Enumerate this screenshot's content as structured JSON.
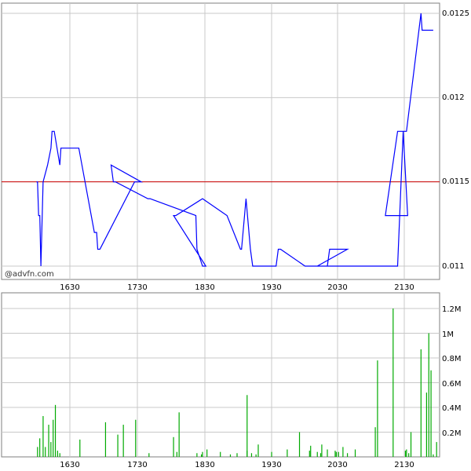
{
  "watermark": "@advfn.com",
  "price_panel": {
    "y_ticks": [
      "0.0125",
      "0.012",
      "0.0115",
      "0.011"
    ],
    "x_ticks": [
      "1630",
      "1730",
      "1830",
      "1930",
      "2030",
      "2130"
    ],
    "reference_level": 0.0115,
    "line_color": "#0000ff",
    "reference_color": "#cc0000"
  },
  "volume_panel": {
    "y_ticks": [
      "1.2M",
      "1M",
      "0.8M",
      "0.6M",
      "0.4M",
      "0.2M"
    ],
    "x_ticks": [
      "1630",
      "1730",
      "1830",
      "1930",
      "2030",
      "2130"
    ],
    "bar_color": "#00aa00"
  },
  "chart_data": [
    {
      "type": "line",
      "series": [
        {
          "x": [
            1600,
            1601,
            1602,
            1603,
            1604,
            1606,
            1610,
            1613,
            1614,
            1615,
            1615.5,
            1616,
            1621,
            1622,
            1631,
            1632,
            1636,
            1637,
            1638,
            1652,
            1653,
            1654,
            1655,
            1656,
            1657,
            1688,
            1689,
            1690,
            1694,
            1707,
            1709,
            1711,
            1740,
            1742,
            1783,
            1784,
            1789,
            1792,
            1803,
            1805,
            1829,
            1851,
            1903,
            1904,
            1908,
            1912,
            1914,
            1935,
            1937,
            1939,
            1961,
            1981,
            1983,
            1999,
            2012,
            2015,
            2084,
            2089,
            2093,
            2113,
            2124,
            2126,
            2132,
            2145,
            2146,
            2151,
            2152,
            2153,
            2154,
            2155,
            2156
          ],
          "y": [
            0.0115,
            0.0115,
            0.0113,
            0.0113,
            0.011,
            0.0115,
            0.0116,
            0.0117,
            0.0118,
            0.0118,
            0.0118,
            0.0118,
            0.0116,
            0.0117,
            0.0117,
            0.0117,
            0.0117,
            0.0117,
            0.0117,
            0.0112,
            0.0112,
            0.0112,
            0.0111,
            0.0111,
            0.0111,
            0.0115,
            0.0115,
            0.0115,
            0.0115,
            0.0116,
            0.0115,
            0.0115,
            0.0114,
            0.0114,
            0.0113,
            0.0111,
            0.011,
            0.011,
            0.0113,
            0.0113,
            0.0114,
            0.0113,
            0.0111,
            0.0111,
            0.0114,
            0.0111,
            0.011,
            0.011,
            0.0111,
            0.0111,
            0.011,
            0.011,
            0.0111,
            0.0111,
            0.011,
            0.011,
            0.011,
            0.0118,
            0.0113,
            0.0113,
            0.0118,
            0.0118,
            0.0118,
            0.0125,
            0.0124,
            0.0124,
            0.0124,
            0.0124,
            0.0124,
            0.0124,
            0.0124
          ]
        }
      ],
      "xlim": [
        1600,
        2160
      ],
      "ylim": [
        0.01095,
        0.0126
      ]
    },
    {
      "type": "bar",
      "x": [
        1601,
        1603,
        1606,
        1608,
        1611,
        1613,
        1615,
        1617,
        1619,
        1621,
        1639,
        1662,
        1678,
        1689,
        1713,
        1741,
        1766,
        1784,
        1789,
        1793,
        1803,
        1808,
        1828,
        1845,
        1854,
        1869,
        1879,
        1900,
        1909,
        1913,
        1917,
        1931,
        1945,
        1956,
        1966,
        1975,
        1981,
        1989,
        1995,
        1999,
        2005,
        2012,
        2016,
        2028,
        2031,
        2046,
        2064,
        2092,
        2096,
        2106,
        2120,
        2131,
        2134,
        2145,
        2150,
        2152,
        2154,
        2156,
        2159
      ],
      "values": [
        0.08,
        0.15,
        0.33,
        0.08,
        0.26,
        0.12,
        0.3,
        0.42,
        0.05,
        0.03,
        0.14,
        0.28,
        0.26,
        0.3,
        0.18,
        0.03,
        0.04,
        0.03,
        0.04,
        0.06,
        0.16,
        0.36,
        0.02,
        0.04,
        0.02,
        0.05,
        0.1,
        0.03,
        0.5,
        0.03,
        0.02,
        0.04,
        0.06,
        0.2,
        0.09,
        0.03,
        0.06,
        0.04,
        0.08,
        0.03,
        0.05,
        0.04,
        0.1,
        0.05,
        0.04,
        0.06,
        0.24,
        0.06,
        0.2,
        0.78,
        1.2,
        0.05,
        0.03,
        0.87,
        0.52,
        1.0,
        0.7,
        0.02,
        0.12
      ],
      "ylim": [
        0,
        1.3
      ]
    }
  ]
}
